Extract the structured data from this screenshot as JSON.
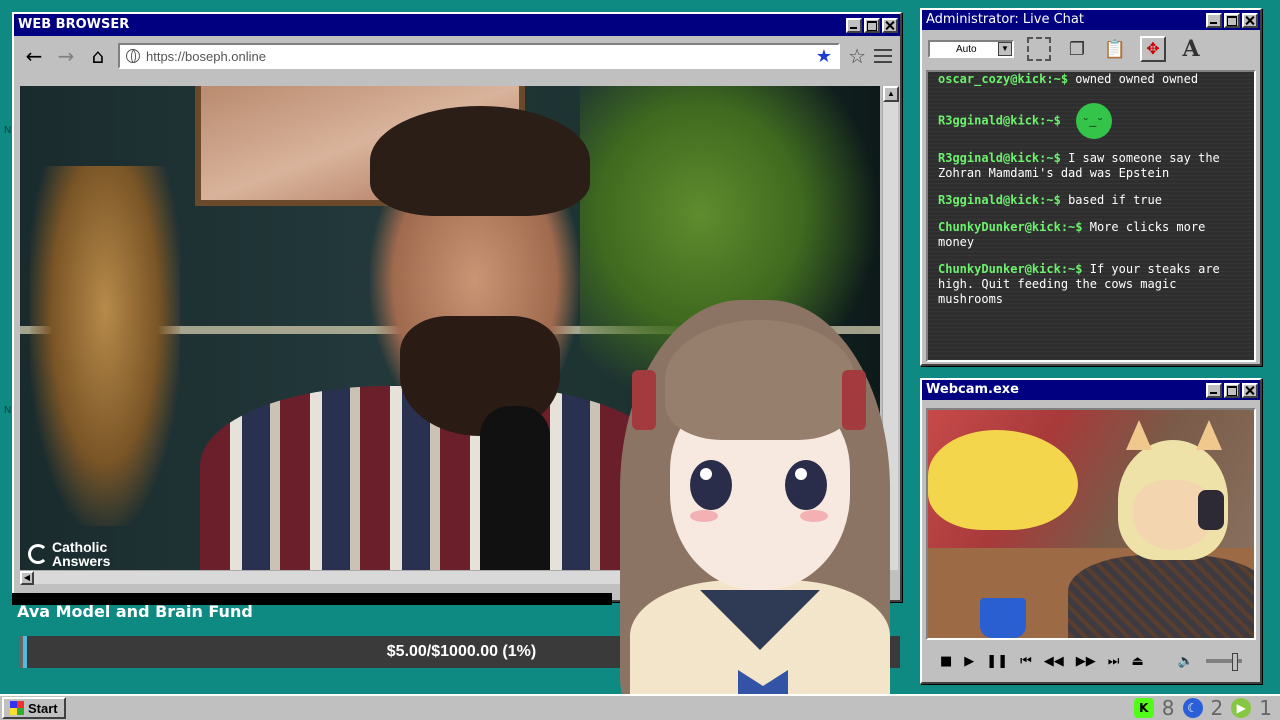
{
  "browser": {
    "title": "WEB BROWSER",
    "url": "https://boseph.online",
    "video_logo": "Catholic Answers"
  },
  "fund": {
    "title": "Ava Model and Brain Fund",
    "progress_text": "$5.00/$1000.00 (1%)",
    "progress_fraction": 0.005,
    "current": 5.0,
    "goal": 1000.0
  },
  "chat": {
    "title": "Administrator: Live Chat",
    "size_select": "Auto",
    "messages": [
      {
        "user": "oscar_cozy@kick:~$",
        "text": "owned owned owned"
      },
      {
        "user": "R3gginald@kick:~$",
        "text": "",
        "emote": "green-face-emote"
      },
      {
        "user": "R3gginald@kick:~$",
        "text": "I saw someone say the Zohran Mamdami's dad was Epstein"
      },
      {
        "user": "R3gginald@kick:~$",
        "text": "based if true"
      },
      {
        "user": "ChunkyDunker@kick:~$",
        "text": "More clicks more money"
      },
      {
        "user": "ChunkyDunker@kick:~$",
        "text": "If your steaks are high. Quit feeding the cows magic mushrooms"
      }
    ]
  },
  "webcam": {
    "title": "Webcam.exe"
  },
  "taskbar": {
    "start_label": "Start",
    "kick_count": "8",
    "moon_count": "2",
    "rumble_count": "1"
  },
  "colors": {
    "desktop": "#0e8a82",
    "titlebar": "#000080",
    "chat_username": "#6df06d",
    "fund_bar": "#3a3a3a"
  }
}
